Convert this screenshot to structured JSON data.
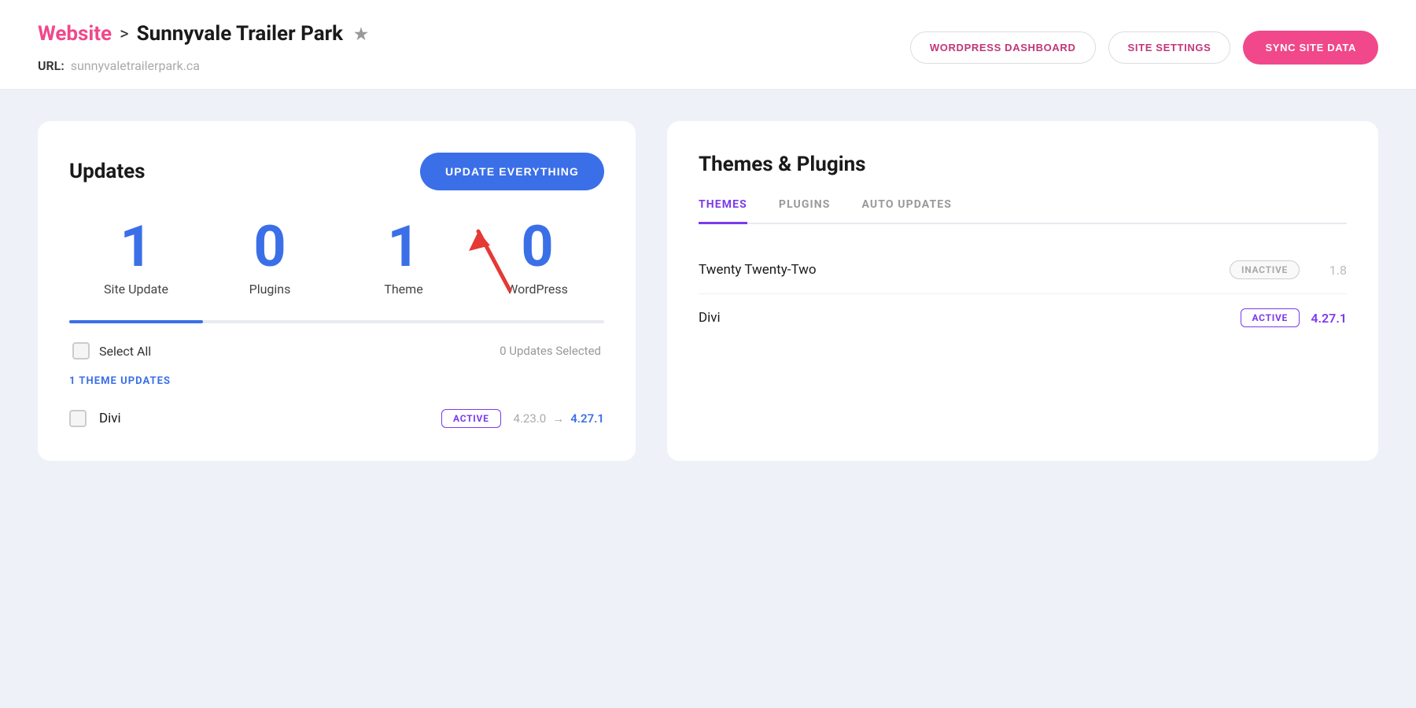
{
  "header": {
    "breadcrumb_website": "Website",
    "breadcrumb_separator": ">",
    "breadcrumb_site": "Sunnyvale Trailer Park",
    "url_label": "URL:",
    "url_value": "sunnyvaletrailerpark.ca",
    "btn_wordpress_dashboard": "WORDPRESS DASHBOARD",
    "btn_site_settings": "SITE SETTINGS",
    "btn_sync_site_data": "SYNC SITE DATA"
  },
  "updates_panel": {
    "title": "Updates",
    "btn_update_everything": "UPDATE EVERYTHING",
    "stats": [
      {
        "number": "1",
        "label": "Site Update"
      },
      {
        "number": "0",
        "label": "Plugins"
      },
      {
        "number": "1",
        "label": "Theme"
      },
      {
        "number": "0",
        "label": "WordPress"
      }
    ],
    "select_all_label": "Select All",
    "updates_selected": "0 Updates Selected",
    "theme_updates_label": "1 THEME UPDATES",
    "update_item": {
      "name": "Divi",
      "badge": "ACTIVE",
      "version_from": "4.23.0",
      "arrow": "→",
      "version_to": "4.27.1"
    }
  },
  "themes_panel": {
    "title": "Themes & Plugins",
    "tabs": [
      {
        "label": "THEMES",
        "active": true
      },
      {
        "label": "PLUGINS",
        "active": false
      },
      {
        "label": "AUTO UPDATES",
        "active": false
      }
    ],
    "themes": [
      {
        "name": "Twenty Twenty-Two",
        "status": "INACTIVE",
        "status_type": "inactive",
        "version": "1.8"
      },
      {
        "name": "Divi",
        "status": "ACTIVE",
        "status_type": "active",
        "version": "4.27.1"
      }
    ]
  }
}
